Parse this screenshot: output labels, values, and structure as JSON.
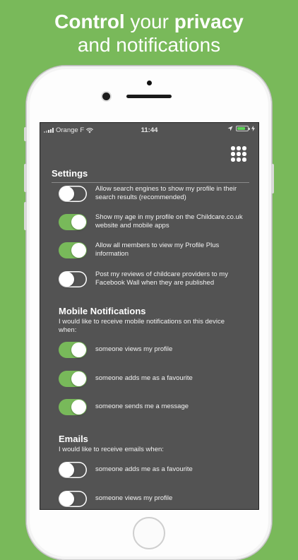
{
  "promo": {
    "line1_bold_1": "Control",
    "line1_regular": " your ",
    "line1_bold_2": "privacy",
    "line2": "and notifications"
  },
  "status_bar": {
    "carrier": "Orange F",
    "time": "11:44",
    "battery_level": 0.75
  },
  "menu_icon": "grid-menu-icon",
  "settings": {
    "title": "Settings",
    "items": [
      {
        "label": "Allow search engines to show my profile in their search results (recommended)",
        "on": false
      },
      {
        "label": "Show my age in my profile on the Childcare.co.uk website and mobile apps",
        "on": true
      },
      {
        "label": "Allow all members to view my Profile Plus information",
        "on": true
      },
      {
        "label": "Post my reviews of childcare providers to my Facebook Wall when they are published",
        "on": false
      }
    ]
  },
  "mobile_notifications": {
    "title": "Mobile Notifications",
    "description": "I would like to receive mobile notifications on this device when:",
    "items": [
      {
        "label": "someone views my profile",
        "on": true
      },
      {
        "label": "someone adds me as a favourite",
        "on": true
      },
      {
        "label": "someone sends me a message",
        "on": true
      }
    ]
  },
  "emails": {
    "title": "Emails",
    "description": "I would like to receive emails when:",
    "items": [
      {
        "label": "someone adds me as a favourite",
        "on": false
      },
      {
        "label": "someone views my profile",
        "on": false
      }
    ]
  },
  "colors": {
    "background_green": "#79b95a",
    "toggle_on": "#78b95a",
    "screen_bg": "#535353"
  }
}
